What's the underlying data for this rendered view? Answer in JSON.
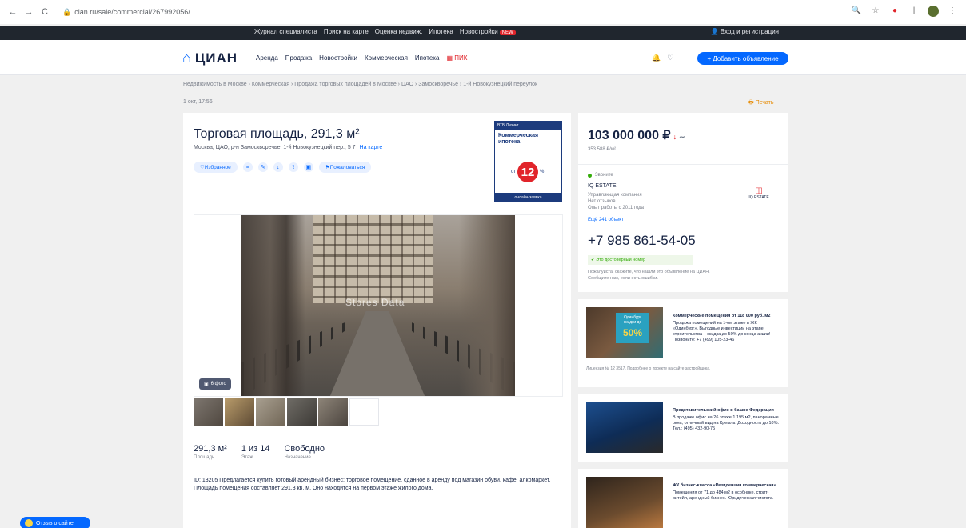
{
  "browser": {
    "url": "cian.ru/sale/commercial/267992056/",
    "back": "←",
    "forward": "→",
    "reload": "C"
  },
  "topbar": {
    "links": [
      "Журнал специалиста",
      "Поиск на карте",
      "Оценка недвиж.",
      "Ипотека",
      "Новостройки"
    ],
    "badge": "NEW",
    "login": "Вход и регистрация"
  },
  "header": {
    "logo_text": "ЦИАН",
    "nav": [
      "Аренда",
      "Продажа",
      "Новостройки",
      "Коммерческая",
      "Ипотека"
    ],
    "nav_pik": "ПИК",
    "add_button": "+ Добавить объявление"
  },
  "breadcrumbs": "Недвижимость в Москве › Коммерческая › Продажа торговых площадей в Москве › ЦАО › Замоскворечье › 1-й Новокузнецкий переулок",
  "published": "1 окт, 17:56",
  "print_label": "Печать",
  "listing": {
    "title": "Торговая площадь, 291,3 м²",
    "address": "Москва, ЦАО, р-н Замоскворечье, 1-й Новокузнецкий пер., 5 7",
    "map_link": "На карте",
    "actions": {
      "favorite": "Избранное",
      "complain": "Пожаловаться"
    },
    "photo_watermark": "Stores Data",
    "photo_count": "6 фото",
    "specs": [
      {
        "value": "291,3 м²",
        "label": "Площадь"
      },
      {
        "value": "1 из 14",
        "label": "Этаж"
      },
      {
        "value": "Свободно",
        "label": "Назначение"
      }
    ],
    "description": "ID: 13205 Предлагается купить готовый арендный бизнес: торговое помещение, сданное в аренду под магазин обуви, кафе, алкомаркет. Площадь помещения составляет 291,3 кв. м. Оно находится на первом этаже жилого дома."
  },
  "ad_banner": {
    "brand": "ВТБ Лизинг",
    "headline": "Коммерческая ипотека",
    "rate_prefix": "от",
    "rate": "12",
    "rate_suffix": "%",
    "cta": "онлайн-заявка"
  },
  "price_card": {
    "price": "103 000 000 ₽",
    "price_arrow": "↓",
    "price_icon": "∼",
    "price_per_m2": "353 588 ₽/м²",
    "status": "Звоните",
    "agent_name": "IQ ESTATE",
    "agent_meta": [
      "Управляющая компания",
      "Нет отзывов",
      "Опыт работы с 2011 года"
    ],
    "agent_more": "Ещё 241 объект",
    "agent_logo": "IQ ESTATE",
    "phone": "+7 985 861-54-05",
    "verified": "Это достоверный номер",
    "phone_note": "Пожалуйста, скажите, что нашли это объявление на ЦИАН. Сообщите нам, если есть ошибки."
  },
  "side_ads": [
    {
      "title": "Коммерческие помещения от 118 000 руб./м2",
      "body": "Продажа помещений на 1-ом этаже в ЖК «Одинбург». Выгодные инвестиции на этапе строительства – скидка до 50% до конца акции! Позвоните: +7 (499) 105-23-46",
      "badge_brand": "Одинбург",
      "badge_label": "скидки до",
      "badge_value": "50%",
      "footer": "Лицензия № 12 3517. Подробнее о проекте на сайте застройщика."
    },
    {
      "title": "Представительский офис в башне Федерация",
      "body": "В продаже офис на 26 этаже 1 195 м2, панорамные окна, отличный вид на Кремль. Доходность до 10%. Тел.: (495) 432-90-75"
    },
    {
      "title": "ЖК бизнес-класса «Резиденция коммерческая»",
      "body": "Помещения от 71 до 484 м2 в особняке, стрит-ритейл, арендный бизнес. Юридическая чистота."
    }
  ],
  "feedback": "Отзыв о сайте"
}
